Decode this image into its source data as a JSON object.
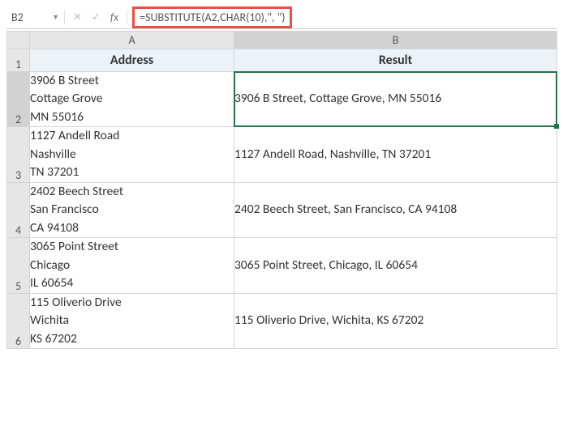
{
  "formula_bar": {
    "name_box": "B2",
    "formula": "=SUBSTITUTE(A2,CHAR(10),\", \")"
  },
  "columns": [
    "A",
    "B"
  ],
  "headers": {
    "A": "Address",
    "B": "Result"
  },
  "rows": [
    {
      "n": "1"
    },
    {
      "n": "2",
      "A": "3906 B Street\nCottage Grove\nMN 55016",
      "B": "3906 B Street, Cottage Grove, MN 55016"
    },
    {
      "n": "3",
      "A": "1127 Andell Road\nNashville\nTN 37201",
      "B": "1127 Andell Road, Nashville, TN 37201"
    },
    {
      "n": "4",
      "A": "2402 Beech Street\nSan Francisco\nCA 94108",
      "B": "2402 Beech Street, San Francisco, CA 94108"
    },
    {
      "n": "5",
      "A": "3065 Point Street\nChicago\nIL 60654",
      "B": "3065 Point Street, Chicago, IL 60654"
    },
    {
      "n": "6",
      "A": "115 Oliverio Drive\nWichita\nKS 67202",
      "B": "115 Oliverio Drive, Wichita, KS 67202"
    }
  ]
}
